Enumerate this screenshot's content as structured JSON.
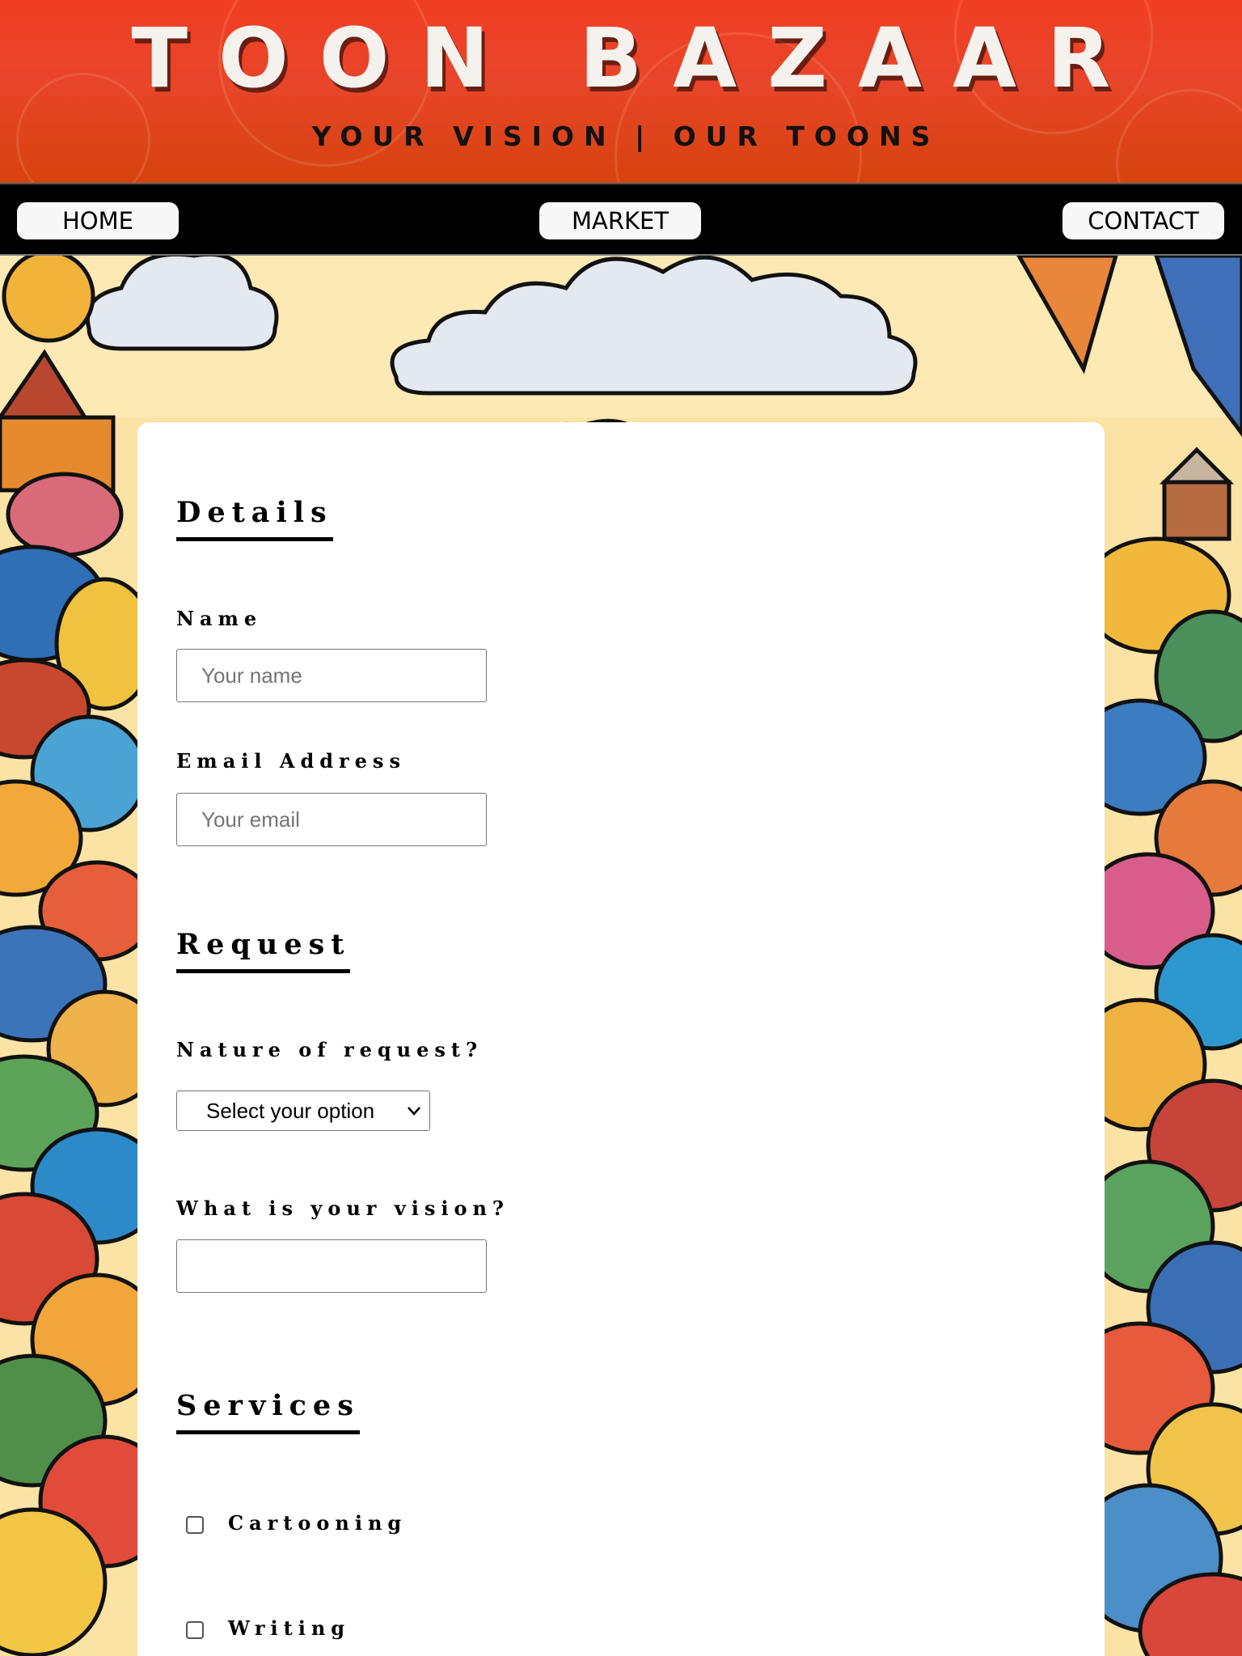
{
  "header": {
    "title": "TOON BAZAAR",
    "tagline": "YOUR VISION | OUR TOONS"
  },
  "nav": {
    "home": "HOME",
    "market": "MARKET",
    "contact": "CONTACT"
  },
  "form": {
    "details": {
      "heading": "Details",
      "name_label": "Name",
      "name_placeholder": "Your name",
      "email_label": "Email Address",
      "email_placeholder": "Your email"
    },
    "request": {
      "heading": "Request",
      "nature_label": "Nature of request?",
      "nature_selected": "Select your option",
      "vision_label": "What is your vision?",
      "vision_value": ""
    },
    "services": {
      "heading": "Services",
      "options": [
        "Cartooning",
        "Writing"
      ]
    }
  },
  "colors": {
    "header_red": "#f03e24",
    "nav_black": "#000000",
    "card_white": "#ffffff",
    "sky_yellow": "#fbe3a6"
  }
}
